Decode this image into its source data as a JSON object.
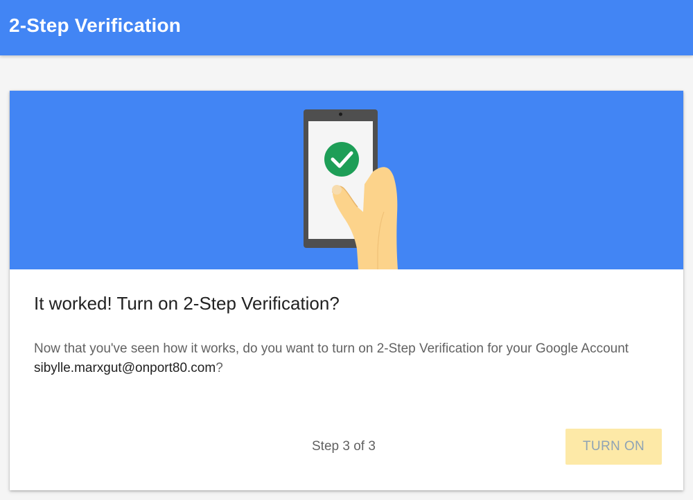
{
  "header": {
    "title": "2-Step Verification"
  },
  "hero": {
    "illustration": "phone-with-checkmark",
    "background_color": "#4285f4",
    "check_color": "#1e9e57"
  },
  "card": {
    "title": "It worked! Turn on 2-Step Verification?",
    "description_prefix": "Now that you've seen how it works, do you want to turn on 2-Step Verification for your Google Account ",
    "email": "sibylle.marxgut@onport80.com",
    "description_suffix": "?",
    "step_text": "Step 3 of 3",
    "turn_on_label": "TURN ON",
    "turn_on_color": "#fde9a7"
  }
}
